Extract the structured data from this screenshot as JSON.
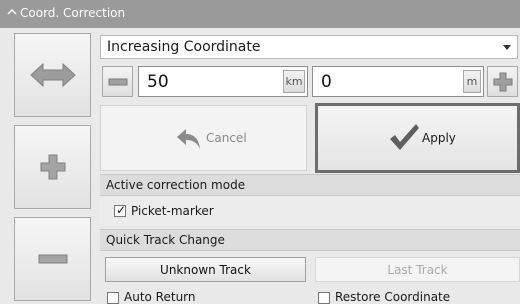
{
  "panel": {
    "title": "Coord. Correction"
  },
  "mode_select": {
    "value": "Increasing Coordinate"
  },
  "left_field": {
    "value": "50",
    "unit": "km"
  },
  "right_field": {
    "value": "0",
    "unit": "m"
  },
  "actions": {
    "cancel_label": "Cancel",
    "apply_label": "Apply"
  },
  "active_mode": {
    "title": "Active correction mode",
    "picket_marker_label": "Picket-marker",
    "picket_marker_checked": true
  },
  "quick_track": {
    "title": "Quick Track Change",
    "unknown_track_label": "Unknown Track",
    "last_track_label": "Last Track",
    "auto_return_label": "Auto Return",
    "restore_coordinate_label": "Restore Coordinate"
  },
  "icons": {
    "collapse": "chevron-up-icon",
    "swap": "double-arrow-icon",
    "plus": "plus-icon",
    "minus": "minus-icon",
    "undo": "undo-arrow-icon",
    "apply": "checkmark-icon"
  }
}
